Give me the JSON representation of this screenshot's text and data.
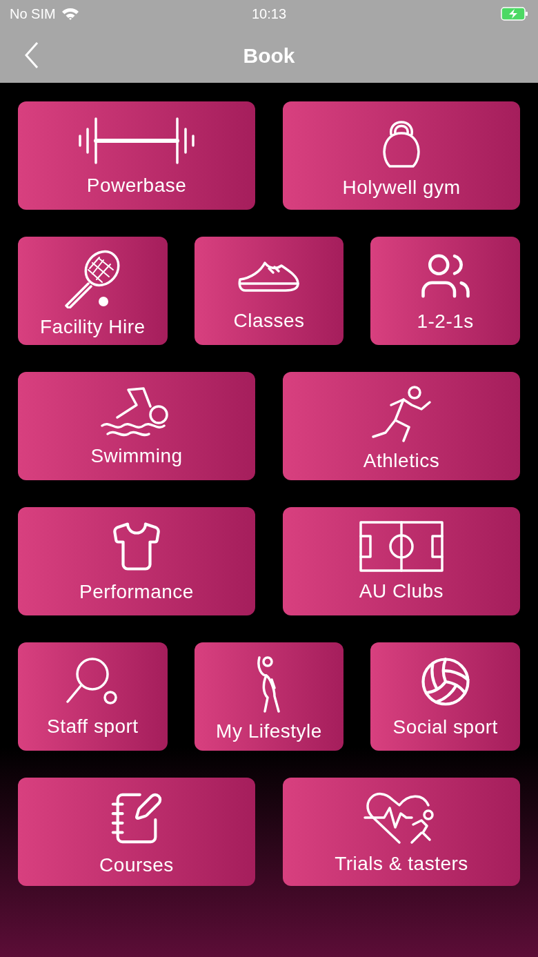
{
  "status_bar": {
    "carrier": "No SIM",
    "time": "10:13"
  },
  "nav": {
    "title": "Book"
  },
  "rows": [
    [
      {
        "label": "Powerbase",
        "kind": "dumbbell"
      },
      {
        "label": "Holywell gym",
        "kind": "kettlebell"
      }
    ],
    [
      {
        "label": "Facility Hire",
        "kind": "racket"
      },
      {
        "label": "Classes",
        "kind": "sneaker"
      },
      {
        "label": "1-2-1s",
        "kind": "people"
      }
    ],
    [
      {
        "label": "Swimming",
        "kind": "swimmer"
      },
      {
        "label": "Athletics",
        "kind": "runner"
      }
    ],
    [
      {
        "label": "Performance",
        "kind": "shirt"
      },
      {
        "label": "AU Clubs",
        "kind": "pitch"
      }
    ],
    [
      {
        "label": "Staff sport",
        "kind": "paddle"
      },
      {
        "label": "My Lifestyle",
        "kind": "stretch"
      },
      {
        "label": "Social sport",
        "kind": "ball"
      }
    ],
    [
      {
        "label": "Courses",
        "kind": "notepad"
      },
      {
        "label": "Trials & tasters",
        "kind": "heartbeat"
      }
    ]
  ]
}
